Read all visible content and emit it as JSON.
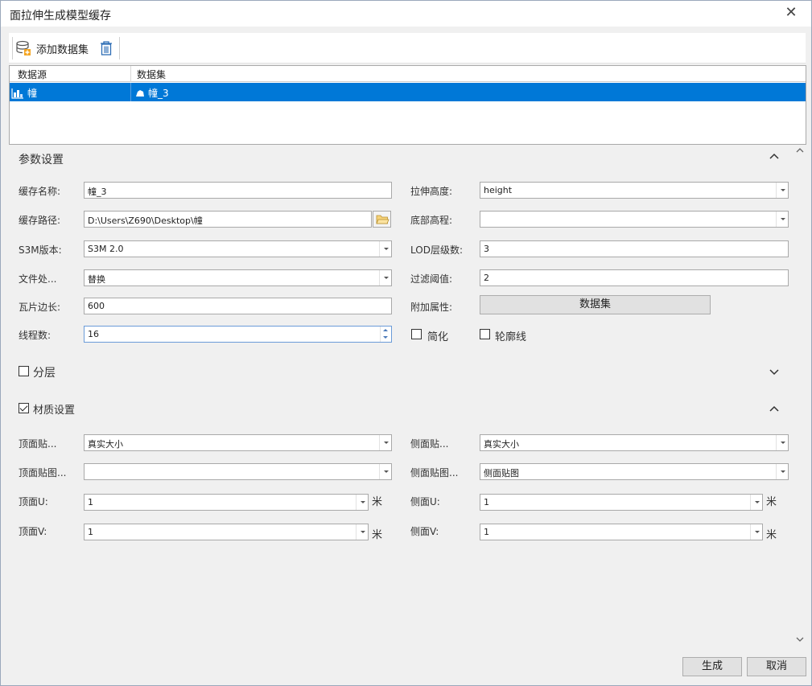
{
  "window": {
    "title": "面拉伸生成模型缓存",
    "close": "✕"
  },
  "toolbar": {
    "add_label": "添加数据集"
  },
  "grid": {
    "headers": [
      "数据源",
      "数据集"
    ],
    "rows": [
      {
        "datasource": "幢",
        "dataset": "幢_3"
      }
    ]
  },
  "params": {
    "title": "参数设置",
    "cache_name": {
      "label": "缓存名称:",
      "value": "幢_3"
    },
    "extrude_height": {
      "label": "拉伸高度:",
      "value": "height"
    },
    "cache_path": {
      "label": "缓存路径:",
      "value": "D:\\Users\\Z690\\Desktop\\幢"
    },
    "bottom_elev": {
      "label": "底部高程:",
      "value": ""
    },
    "s3m_version": {
      "label": "S3M版本:",
      "value": "S3M 2.0"
    },
    "lod_levels": {
      "label": "LOD层级数:",
      "value": "3"
    },
    "file_handling": {
      "label": "文件处...",
      "value": "替换"
    },
    "filter_threshold": {
      "label": "过滤阈值:",
      "value": "2"
    },
    "tile_size": {
      "label": "瓦片边长:",
      "value": "600"
    },
    "extra_attr": {
      "label": "附加属性:",
      "button": "数据集"
    },
    "threads": {
      "label": "线程数:",
      "value": "16"
    },
    "simplify": {
      "label": "简化",
      "checked": false
    },
    "outline": {
      "label": "轮廓线",
      "checked": false
    }
  },
  "layering": {
    "label": "分层",
    "checked": false
  },
  "material": {
    "label": "材质设置",
    "checked": true,
    "top_tex": {
      "label": "顶面贴...",
      "value": "真实大小"
    },
    "side_tex": {
      "label": "侧面贴...",
      "value": "真实大小"
    },
    "top_img": {
      "label": "顶面贴图...",
      "value": ""
    },
    "side_img": {
      "label": "侧面贴图...",
      "value": "侧面贴图"
    },
    "top_u": {
      "label": "顶面U:",
      "value": "1",
      "unit": "米"
    },
    "side_u": {
      "label": "侧面U:",
      "value": "1",
      "unit": "米"
    },
    "top_v": {
      "label": "顶面V:",
      "value": "1",
      "unit": "米"
    },
    "side_v": {
      "label": "侧面V:",
      "value": "1",
      "unit": "米"
    }
  },
  "footer": {
    "generate": "生成",
    "cancel": "取消"
  }
}
